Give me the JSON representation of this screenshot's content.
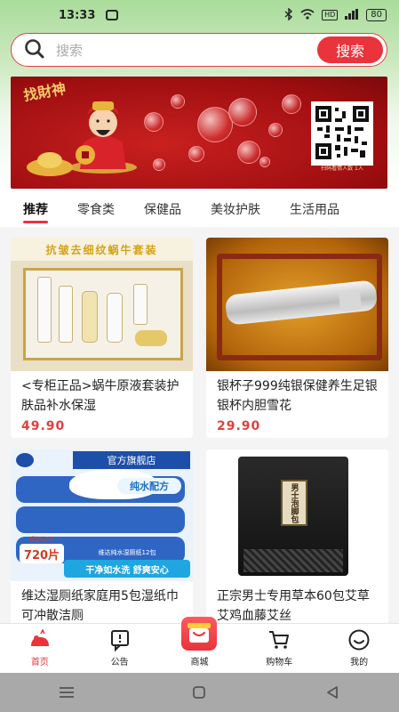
{
  "status_bar": {
    "time": "13:33",
    "network": "HD",
    "battery": "80"
  },
  "search": {
    "placeholder": "搜索",
    "button_label": "搜索"
  },
  "banner": {
    "title_text": "找財神",
    "qr_caption": "扫码看情人数 1人"
  },
  "tabs": [
    {
      "label": "推荐",
      "active": true
    },
    {
      "label": "零食类",
      "active": false
    },
    {
      "label": "保健品",
      "active": false
    },
    {
      "label": "美妆护肤",
      "active": false
    },
    {
      "label": "生活用品",
      "active": false
    }
  ],
  "products": [
    {
      "image_caption": "抗皱去细纹蜗牛套装",
      "title": "<专柜正品>蜗牛原液套装护肤品补水保湿",
      "price": "49.90"
    },
    {
      "title": " 银杯子999纯银保健养生足银银杯内胆雪花",
      "price": "29.90"
    },
    {
      "image_caption": "官方旗舰店",
      "image_badge_small": "超值装1包",
      "image_badge": "720片",
      "image_pack_label": "纯水配方",
      "image_product_line": "维达纯水湿厕纸12包",
      "image_slogan": "干净如水洗 舒爽安心",
      "title": "维达湿厕纸家庭用5包湿纸巾可冲散洁厕",
      "price": ""
    },
    {
      "image_caption": "男士泡脚包",
      "title": "正宗男士专用草本60包艾草艾鸡血藤艾丝",
      "price": ""
    }
  ],
  "bottom_nav": [
    {
      "label": "首页",
      "icon": "home-icon",
      "active": true
    },
    {
      "label": "公告",
      "icon": "notice-icon",
      "active": false
    },
    {
      "label": "商城",
      "icon": "mall-bag-icon",
      "active": false
    },
    {
      "label": "购物车",
      "icon": "cart-icon",
      "active": false
    },
    {
      "label": "我的",
      "icon": "profile-icon",
      "active": false
    }
  ],
  "colors": {
    "accent": "#e8343a",
    "price": "#e0403f",
    "header_green": "#a9dc9b"
  }
}
